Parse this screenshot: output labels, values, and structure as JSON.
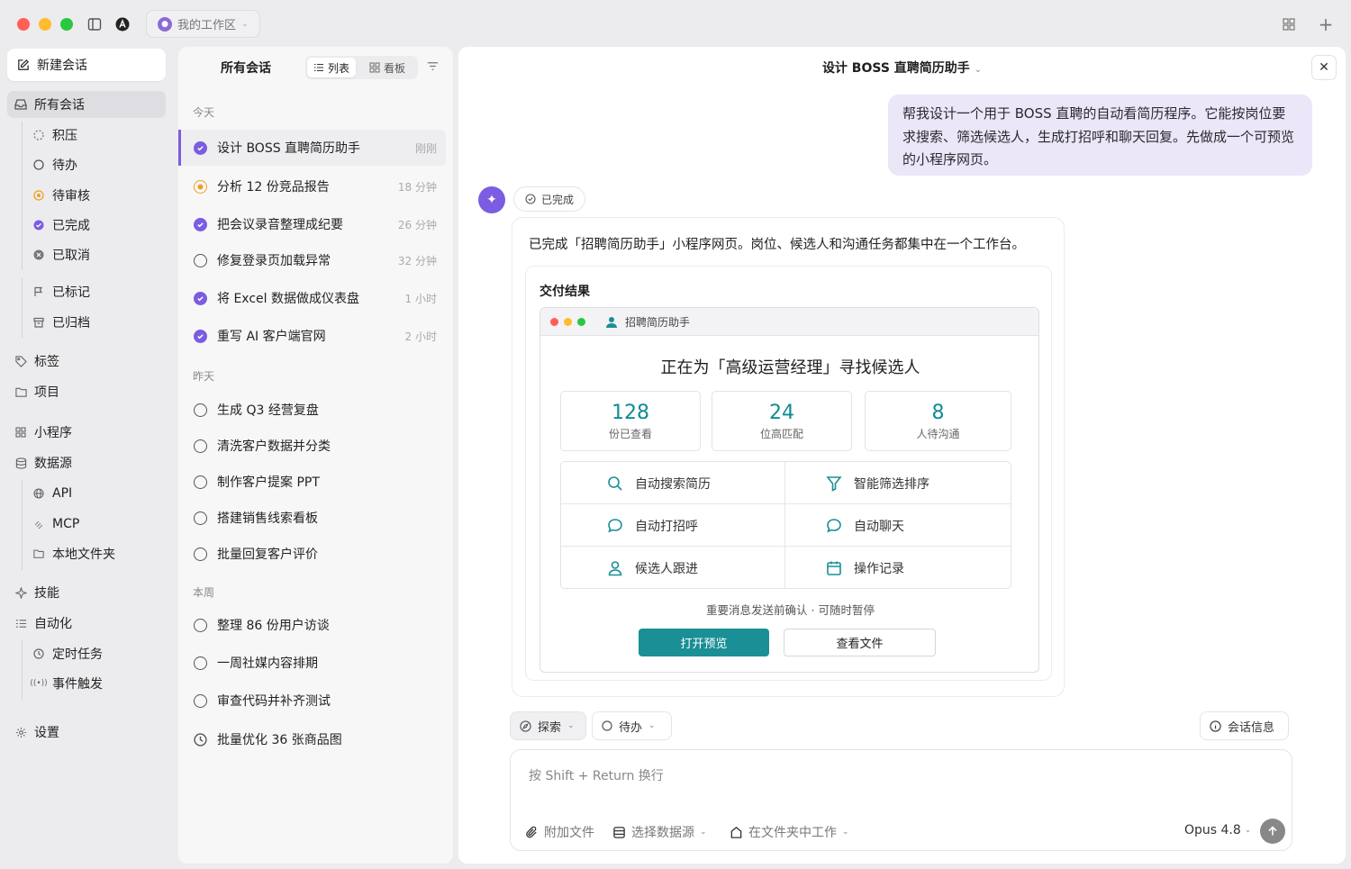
{
  "window": {
    "workspace": "我的工作区"
  },
  "sidebar": {
    "new_chat": "新建会话",
    "all_chats": "所有会话",
    "status_items": [
      "积压",
      "待办",
      "待审核",
      "已完成",
      "已取消"
    ],
    "flagged": "已标记",
    "archived": "已归档",
    "tags": "标签",
    "projects": "项目",
    "mini_programs": "小程序",
    "data_sources": "数据源",
    "data_source_items": [
      "API",
      "MCP",
      "本地文件夹"
    ],
    "skills": "技能",
    "automation": "自动化",
    "automation_items": [
      "定时任务",
      "事件触发"
    ],
    "settings": "设置"
  },
  "list_panel": {
    "title": "所有会话",
    "view_list": "列表",
    "view_board": "看板",
    "groups": [
      {
        "label": "今天",
        "items": [
          {
            "title": "设计 BOSS 直聘简历助手",
            "time": "刚刚",
            "status": "done",
            "active": true
          },
          {
            "title": "分析 12 份竞品报告",
            "time": "18 分钟",
            "status": "review"
          },
          {
            "title": "把会议录音整理成纪要",
            "time": "26 分钟",
            "status": "done"
          },
          {
            "title": "修复登录页加载异常",
            "time": "32 分钟",
            "status": "open"
          },
          {
            "title": "将 Excel 数据做成仪表盘",
            "time": "1 小时",
            "status": "done"
          },
          {
            "title": "重写 AI 客户端官网",
            "time": "2 小时",
            "status": "done"
          }
        ]
      },
      {
        "label": "昨天",
        "items": [
          {
            "title": "生成 Q3 经营复盘",
            "time": "",
            "status": "open"
          },
          {
            "title": "清洗客户数据并分类",
            "time": "",
            "status": "open"
          },
          {
            "title": "制作客户提案 PPT",
            "time": "",
            "status": "open"
          },
          {
            "title": "搭建销售线索看板",
            "time": "",
            "status": "open"
          },
          {
            "title": "批量回复客户评价",
            "time": "",
            "status": "open"
          }
        ]
      },
      {
        "label": "本周",
        "items": [
          {
            "title": "整理 86 份用户访谈",
            "time": "",
            "status": "open"
          },
          {
            "title": "一周社媒内容排期",
            "time": "",
            "status": "open"
          },
          {
            "title": "审查代码并补齐测试",
            "time": "",
            "status": "open"
          },
          {
            "title": "批量优化 36 张商品图",
            "time": "",
            "status": "scheduled"
          }
        ]
      }
    ]
  },
  "main": {
    "title": "设计 BOSS 直聘简历助手",
    "user_message": "帮我设计一个用于 BOSS 直聘的自动看简历程序。它能按岗位要求搜索、筛选候选人，生成打招呼和聊天回复。先做成一个可预览的小程序网页。",
    "status_pill": "已完成",
    "answer_text": "已完成「招聘简历助手」小程序网页。岗位、候选人和沟通任务都集中在一个工作台。",
    "deliverable_title": "交付结果",
    "mini_app": {
      "name": "招聘简历助手",
      "headline": "正在为「高级运营经理」寻找候选人",
      "stats": [
        {
          "value": "128",
          "label": "份已查看"
        },
        {
          "value": "24",
          "label": "位高匹配"
        },
        {
          "value": "8",
          "label": "人待沟通"
        }
      ],
      "features": [
        {
          "label": "自动搜索简历",
          "icon": "search-icon"
        },
        {
          "label": "智能筛选排序",
          "icon": "filter-icon"
        },
        {
          "label": "自动打招呼",
          "icon": "chat-bubble-icon"
        },
        {
          "label": "自动聊天",
          "icon": "chat-bubble-icon"
        },
        {
          "label": "候选人跟进",
          "icon": "user-icon"
        },
        {
          "label": "操作记录",
          "icon": "calendar-icon"
        }
      ],
      "note": "重要消息发送前确认 · 可随时暂停",
      "open_preview": "打开预览",
      "view_files": "查看文件"
    },
    "chips": {
      "explore": "探索",
      "todo": "待办",
      "chat_info": "会话信息"
    },
    "composer": {
      "placeholder": "按 Shift + Return 换行",
      "attach": "附加文件",
      "select_source": "选择数据源",
      "work_in_folder": "在文件夹中工作",
      "model": "Opus 4.8"
    }
  },
  "colors": {
    "accent": "#7c5ce0",
    "teal": "#1a8f95",
    "review": "#f0a020"
  }
}
